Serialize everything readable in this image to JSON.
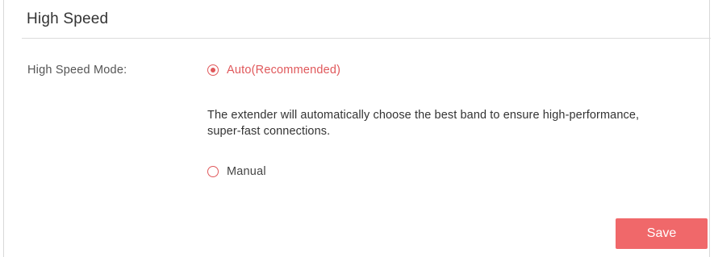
{
  "section": {
    "title": "High Speed"
  },
  "high_speed_mode": {
    "label": "High Speed Mode:",
    "options": [
      {
        "label": "Auto(Recommended)",
        "selected": true
      },
      {
        "label": "Manual",
        "selected": false
      }
    ],
    "auto_description": "The extender will automatically choose the best band to ensure high-performance, super-fast connections."
  },
  "actions": {
    "save_label": "Save"
  },
  "colors": {
    "accent": "#e0585b",
    "button": "#f0686a"
  }
}
